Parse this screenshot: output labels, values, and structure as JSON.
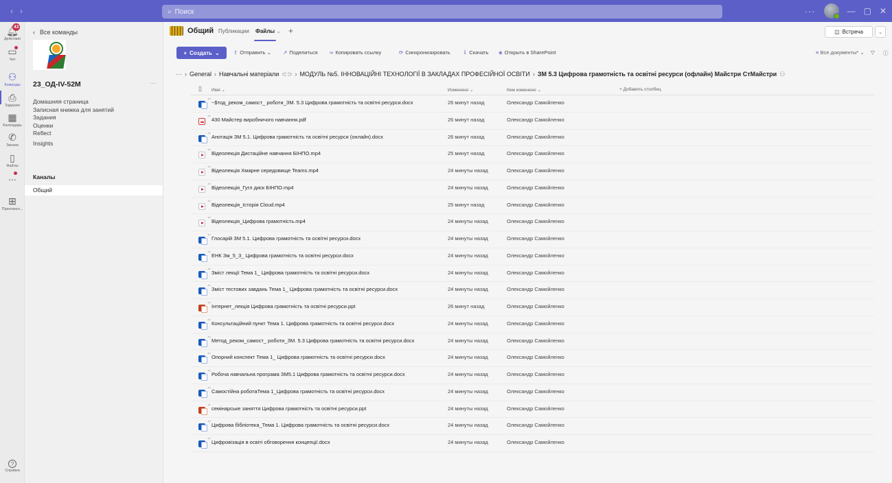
{
  "titlebar": {
    "search_placeholder": "Поиск",
    "nav_back": "‹",
    "nav_forward": "›",
    "more": "···",
    "window_minimize": "—",
    "window_restore": "▢",
    "window_close": "✕"
  },
  "rail": {
    "items": [
      {
        "label": "Действия",
        "icon": "bell-icon",
        "badge": "43"
      },
      {
        "label": "Чат",
        "icon": "chat-icon"
      },
      {
        "label": "Команды",
        "icon": "teams-icon"
      },
      {
        "label": "Задания",
        "icon": "assignments-icon"
      },
      {
        "label": "Календарь",
        "icon": "calendar-icon"
      },
      {
        "label": "Звонки",
        "icon": "phone-icon"
      },
      {
        "label": "Файлы",
        "icon": "file-icon"
      },
      {
        "label": "...",
        "icon": "more-icon"
      },
      {
        "label": "Приложен...",
        "icon": "apps-icon"
      }
    ],
    "help_label": "Справка"
  },
  "teampane": {
    "back_label": "Все команды",
    "team_name": "23_ОД-IV-52М",
    "links": [
      "Домашняя страница",
      "Записная книжка для занятий",
      "Задания",
      "Оценки",
      "Reflect",
      "Insights"
    ],
    "channels_title": "Каналы",
    "channel": "Общий"
  },
  "header": {
    "title": "Общий",
    "tabs": [
      "Публикации",
      "Файлы"
    ],
    "add_tab": "+",
    "meet_label": "Встреча"
  },
  "toolbar": {
    "create": "Создать",
    "actions": [
      {
        "label": "Отправить",
        "icon": "upload-icon"
      },
      {
        "label": "Поделиться",
        "icon": "share-icon"
      },
      {
        "label": "Копировать ссылку",
        "icon": "link-icon"
      },
      {
        "label": "Синхронизировать",
        "icon": "sync-icon"
      },
      {
        "label": "Скачать",
        "icon": "download-icon"
      },
      {
        "label": "Открыть в SharePoint",
        "icon": "sharepoint-icon"
      }
    ],
    "view_label": "Все документы*"
  },
  "breadcrumb": [
    "···",
    "General",
    "Навчальні матеріали",
    "МОДУЛЬ №5. ІННОВАЦІЙНІ ТЕХНОЛОГІЇ В ЗАКЛАДАХ ПРОФЕСІЙНОЇ ОСВІТИ",
    "ЗМ 5.3 Цифрова грамотність та освітні ресурси (офлайн) Майстри СтМайстри"
  ],
  "table": {
    "columns": [
      "Имя",
      "Изменено",
      "Кем изменено",
      "Добавить столбец"
    ],
    "rows": [
      {
        "type": "word",
        "name": "~$тод_реком_самост_ роботи_ЗМ. 5.3 Цифрова грамотність та освітні ресурси.docx",
        "modified": "26 минут назад",
        "by": "Олександр Самойленко"
      },
      {
        "type": "pdf",
        "name": "430 Майстер виробничого навчання.pdf",
        "modified": "26 минут назад",
        "by": "Олександр Самойленко"
      },
      {
        "type": "word",
        "name": "Анотація ЗМ 5.1. Цифрова грамотність та освітні ресурси (онлайн).docx",
        "modified": "26 минут назад",
        "by": "Олександр Самойленко"
      },
      {
        "type": "video",
        "name": "Відеолекція  Дистаційне навчання БІНПО.mp4",
        "modified": "25 минут назад",
        "by": "Олександр Самойленко"
      },
      {
        "type": "video",
        "name": "Відеолекція Хмарне середовище Teams.mp4",
        "modified": "24 минуты назад",
        "by": "Олександр Самойленко"
      },
      {
        "type": "video",
        "name": "Відеолекція_Гугл диск БІНПО.mp4",
        "modified": "24 минуты назад",
        "by": "Олександр Самойленко"
      },
      {
        "type": "video",
        "name": "Відеолекція_Історія Cloud.mp4",
        "modified": "25 минут назад",
        "by": "Олександр Самойленко"
      },
      {
        "type": "video",
        "name": "Відеолекція_Цифрова грамотність.mp4",
        "modified": "24 минуты назад",
        "by": "Олександр Самойленко"
      },
      {
        "type": "word",
        "name": "Глосарій ЗМ 5.1. Цифрова грамотність та освітні ресурси.docx",
        "modified": "24 минуты назад",
        "by": "Олександр Самойленко"
      },
      {
        "type": "word",
        "name": "ЕНК  Зм_5_3_ Цифрова грамотність та освітні ресурси.docx",
        "modified": "24 минуты назад",
        "by": "Олександр Самойленко"
      },
      {
        "type": "word",
        "name": "Зміст лекції Тема 1_ Цифрова грамотність та освітні ресурси.docx",
        "modified": "24 минуты назад",
        "by": "Олександр Самойленко"
      },
      {
        "type": "word",
        "name": "Зміст тестових завдань Тема 1_ Цифрова грамотність та освітні ресурси.docx",
        "modified": "24 минуты назад",
        "by": "Олександр Самойленко"
      },
      {
        "type": "ppt",
        "name": "Інтернет_лекція Цифрова грамотність та освітні ресурси.ppt",
        "modified": "26 минут назад",
        "by": "Олександр Самойленко"
      },
      {
        "type": "word",
        "name": "Консультаційний  пункт Тема 1. Цифрова грамотність та освітні ресурси.docx",
        "modified": "24 минуты назад",
        "by": "Олександр Самойленко"
      },
      {
        "type": "word",
        "name": "Метод_реком_самост_ роботи_ЗМ. 5.3 Цифрова грамотність та освітні ресурси.docx",
        "modified": "24 минуты назад",
        "by": "Олександр Самойленко"
      },
      {
        "type": "word",
        "name": "Опорний конспект Тема 1_ Цифрова грамотність та освітні ресурси.docx",
        "modified": "24 минуты назад",
        "by": "Олександр Самойленко"
      },
      {
        "type": "word",
        "name": "Робоча навчальна програма ЗМ5.1 Цифрова грамотність та освітні ресурси.docx",
        "modified": "24 минуты назад",
        "by": "Олександр Самойленко"
      },
      {
        "type": "word",
        "name": "Самостійна роботаТема 1_Цифрова грамотність та освітні ресурси.docx",
        "modified": "24 минуты назад",
        "by": "Олександр Самойленко"
      },
      {
        "type": "ppt",
        "name": "семінарське заняття Цифрова грамотність та освітні ресурси.ppt",
        "modified": "24 минуты назад",
        "by": "Олександр Самойленко"
      },
      {
        "type": "word",
        "name": "Цифрова бібліотека_Тема 1. Цифрова грамотність та освітні ресурси.docx",
        "modified": "24 минуты назад",
        "by": "Олександр Самойленко"
      },
      {
        "type": "word",
        "name": "Цифровізація в освіті обговорення концепції.docx",
        "modified": "24 минуты назад",
        "by": "Олександр Самойленко"
      }
    ]
  },
  "colors": {
    "accent": "#5b5fc7",
    "badge": "#c4314b"
  }
}
